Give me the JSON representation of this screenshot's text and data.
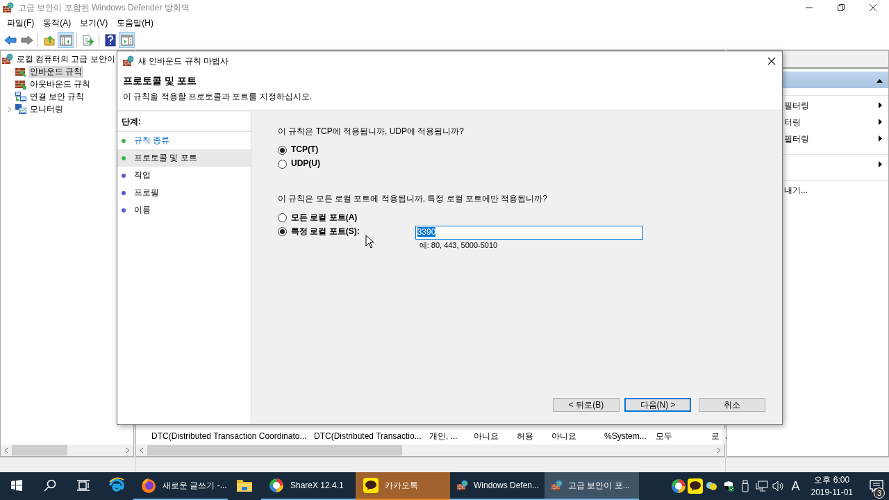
{
  "window": {
    "title": "고급 보안이 포함된 Windows Defender 방화벽"
  },
  "menu": [
    "파일(F)",
    "동작(A)",
    "보기(V)",
    "도움말(H)"
  ],
  "toolbar": [
    {
      "kind": "button",
      "pressed": false
    },
    {
      "kind": "button",
      "pressed": false
    },
    {
      "kind": "separator"
    },
    {
      "kind": "button",
      "pressed": false
    },
    {
      "kind": "button",
      "pressed": true
    },
    {
      "kind": "separator"
    },
    {
      "kind": "button",
      "pressed": false
    },
    {
      "kind": "separator"
    },
    {
      "kind": "button",
      "pressed": false
    },
    {
      "kind": "button",
      "pressed": true
    }
  ],
  "tree": {
    "label": "로컬 컴퓨터의 고급 보안이",
    "selected": false,
    "children": [
      {
        "label": "인바운드 규칙",
        "selected": true
      },
      {
        "label": "아웃바운드 규칙",
        "selected": false
      },
      {
        "label": "연결 보안 규칙",
        "selected": false
      },
      {
        "label": "모니터링",
        "selected": false,
        "expanded": false
      }
    ]
  },
  "table": {
    "rows": [
      {
        "cells": [
          "DTC(Distributed Transaction Coordinato...",
          "DTC(Distributed Transactio...",
          "개인, ...",
          "아니요",
          "허용",
          "아니요",
          "%System...",
          "모두",
          "로"
        ]
      }
    ]
  },
  "actions": {
    "expanded": true,
    "items": [
      {
        "kind": "separator"
      },
      {
        "kind": "item",
        "label": "필터링",
        "submenu": true
      },
      {
        "kind": "item",
        "label": "터링",
        "submenu": true
      },
      {
        "kind": "item",
        "label": "필터링",
        "submenu": true
      },
      {
        "kind": "separator"
      },
      {
        "kind": "item",
        "submenu": true
      },
      {
        "kind": "separator"
      },
      {
        "kind": "item",
        "label": "내기...",
        "submenu": false
      }
    ]
  },
  "dialog": {
    "title": "새 인바운드 규칙 마법사",
    "heading": "프로토콜 및 포트",
    "subtitle": "이 규칙을 적용할 프로토콜과 포트를 지정하십시오.",
    "steps_label": "단계:",
    "steps": [
      {
        "label": "규칙 종류",
        "selected": false,
        "completed": true
      },
      {
        "label": "프로토콜 및 포트",
        "selected": true,
        "completed": true
      },
      {
        "label": "작업",
        "selected": false,
        "completed": false
      },
      {
        "label": "프로필",
        "selected": false,
        "completed": false
      },
      {
        "label": "이름",
        "selected": false,
        "completed": false
      }
    ],
    "questions": [
      {
        "text": "이 규칙은 TCP에 적용됩니까, UDP에 적용됩니까?",
        "options": [
          {
            "label": "TCP(T)",
            "selected": true
          },
          {
            "label": "UDP(U)",
            "selected": false
          }
        ]
      },
      {
        "text": "이 규칙은 모든 로컬 포트에 적용됩니까, 특정 로컬 포트에만 적용됩니까?",
        "options": [
          {
            "label": "모든 로컬 포트(A)",
            "selected": false
          },
          {
            "label": "특정 로컬 포트(S):",
            "selected": true,
            "field": {
              "value": "3390",
              "value_selected": true,
              "hint": "예: 80, 443, 5000-5010"
            }
          }
        ]
      }
    ],
    "buttons": [
      {
        "label": "< 뒤로(B)",
        "default": false
      },
      {
        "label": "다음(N) >",
        "default": true
      },
      {
        "label": "취소",
        "default": false
      }
    ]
  },
  "taskbar": {
    "apps": [
      {
        "running": false,
        "selected": false,
        "flashing": false
      },
      {
        "label": "새로운 글쓰기 -...",
        "running": true,
        "selected": false,
        "flashing": false
      },
      {
        "running": false,
        "selected": false,
        "flashing": false
      },
      {
        "label": "ShareX 12.4.1",
        "running": true,
        "selected": false,
        "flashing": false
      },
      {
        "label": "카카오톡",
        "running": true,
        "selected": false,
        "flashing": true
      },
      {
        "label": "Windows Defen...",
        "running": true,
        "selected": false,
        "flashing": false
      },
      {
        "label": "고급 보안이 포...",
        "running": true,
        "selected": true,
        "flashing": false
      }
    ],
    "input_indicator": "A",
    "time": "오후 6:00",
    "date": "2019-11-01",
    "notifications": "3"
  }
}
